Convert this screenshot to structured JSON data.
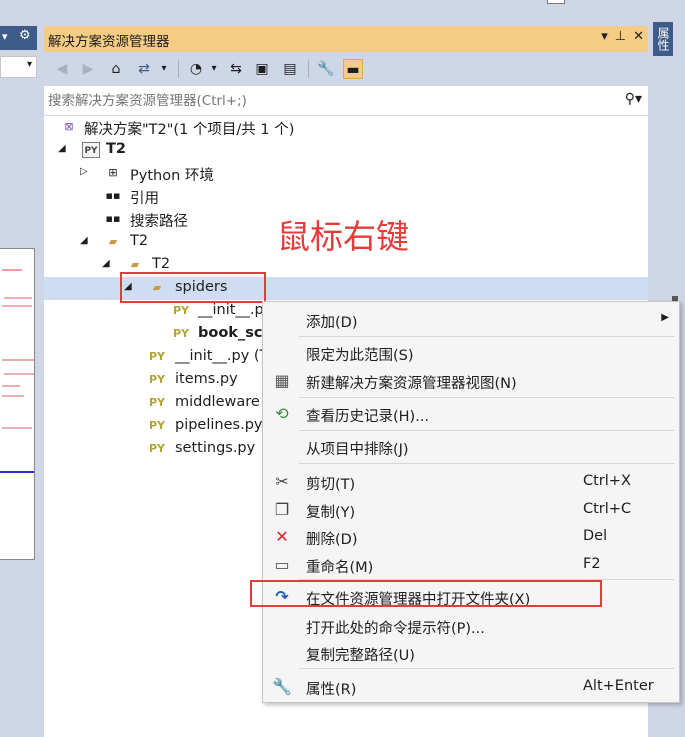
{
  "panel": {
    "title": "解决方案资源管理器",
    "title_buttons": [
      "▾",
      "⊥",
      "✕"
    ],
    "search_placeholder": "搜索解决方案资源管理器(Ctrl+;)"
  },
  "right_tab": "属性",
  "annotation": "鼠标右键",
  "tree": [
    {
      "label": "解决方案\"T2\"(1 个项目/共 1 个)",
      "icon": "solution-icon"
    },
    {
      "label": "T2",
      "icon": "python-project-icon",
      "bold": true
    },
    {
      "label": "Python 环境",
      "icon": "environment-icon"
    },
    {
      "label": "引用",
      "icon": "reference-icon"
    },
    {
      "label": "搜索路径",
      "icon": "search-path-icon"
    },
    {
      "label": "T2",
      "icon": "folder-icon"
    },
    {
      "label": "T2",
      "icon": "package-folder-icon"
    },
    {
      "label": "spiders",
      "icon": "package-folder-icon"
    },
    {
      "label": "__init__.p",
      "icon": "python-file-icon"
    },
    {
      "label": "book_scr",
      "icon": "python-file-icon",
      "bold": true
    },
    {
      "label": "__init__.py (T",
      "icon": "python-file-icon"
    },
    {
      "label": "items.py",
      "icon": "python-file-icon"
    },
    {
      "label": "middleware",
      "icon": "python-file-icon"
    },
    {
      "label": "pipelines.py",
      "icon": "python-file-icon"
    },
    {
      "label": "settings.py",
      "icon": "python-file-icon"
    }
  ],
  "py_badge": "PY",
  "menu": [
    {
      "label": "添加(D)",
      "submenu": true
    },
    {
      "label": "限定为此范围(S)"
    },
    {
      "label": "新建解决方案资源管理器视图(N)",
      "icon": "new-view-icon"
    },
    {
      "label": "查看历史记录(H)...",
      "icon": "history-icon"
    },
    {
      "label": "从项目中排除(J)"
    },
    {
      "label": "剪切(T)",
      "shortcut": "Ctrl+X",
      "icon": "scissors-icon"
    },
    {
      "label": "复制(Y)",
      "shortcut": "Ctrl+C",
      "icon": "copy-icon"
    },
    {
      "label": "删除(D)",
      "shortcut": "Del",
      "icon": "delete-icon"
    },
    {
      "label": "重命名(M)",
      "shortcut": "F2",
      "icon": "rename-icon"
    },
    {
      "label": "在文件资源管理器中打开文件夹(X)",
      "icon": "open-folder-arrow-icon"
    },
    {
      "label": "打开此处的命令提示符(P)..."
    },
    {
      "label": "复制完整路径(U)"
    },
    {
      "label": "属性(R)",
      "shortcut": "Alt+Enter",
      "icon": "wrench-icon"
    }
  ],
  "colors": {
    "title_bar": "#f5cc84",
    "toolbar": "#cfd6e5",
    "selection": "#cfddf3",
    "annotation": "#e43b3b",
    "tab": "#3e5b8a"
  }
}
